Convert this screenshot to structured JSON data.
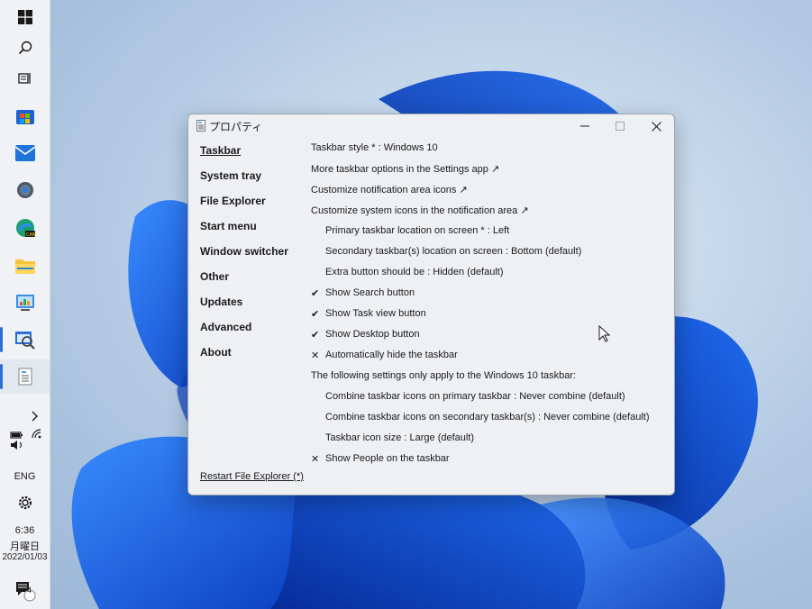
{
  "window": {
    "title": "プロパティ",
    "minimize_glyph": "─",
    "maximize_glyph": "☐",
    "close_glyph": "✕"
  },
  "nav": {
    "items": [
      {
        "label": "Taskbar",
        "active": true
      },
      {
        "label": "System tray"
      },
      {
        "label": "File Explorer"
      },
      {
        "label": "Start menu"
      },
      {
        "label": "Window switcher"
      },
      {
        "label": "Other"
      },
      {
        "label": "Updates"
      },
      {
        "label": "Advanced"
      },
      {
        "label": "About"
      }
    ]
  },
  "settings": {
    "rows": [
      {
        "text": "Taskbar style * : Windows 10",
        "indent": false,
        "mark": ""
      },
      {
        "text": "More taskbar options in the Settings app ↗",
        "indent": false,
        "mark": ""
      },
      {
        "text": "Customize notification area icons ↗",
        "indent": false,
        "mark": ""
      },
      {
        "text": "Customize system icons in the notification area ↗",
        "indent": false,
        "mark": ""
      },
      {
        "text": "Primary taskbar location on screen * : Left",
        "indent": true,
        "mark": ""
      },
      {
        "text": "Secondary taskbar(s) location on screen : Bottom (default)",
        "indent": true,
        "mark": ""
      },
      {
        "text": "Extra button should be : Hidden (default)",
        "indent": true,
        "mark": ""
      },
      {
        "text": "Show Search button",
        "indent": true,
        "mark": "✔"
      },
      {
        "text": "Show Task view button",
        "indent": true,
        "mark": "✔"
      },
      {
        "text": "Show Desktop button",
        "indent": true,
        "mark": "✔"
      },
      {
        "text": "Automatically hide the taskbar",
        "indent": true,
        "mark": "✕"
      },
      {
        "text": "The following settings only apply to the Windows 10 taskbar:",
        "indent": false,
        "mark": ""
      },
      {
        "text": "Combine taskbar icons on primary taskbar : Never combine (default)",
        "indent": true,
        "mark": ""
      },
      {
        "text": "Combine taskbar icons on secondary taskbar(s) : Never combine (default)",
        "indent": true,
        "mark": ""
      },
      {
        "text": "Taskbar icon size : Large (default)",
        "indent": true,
        "mark": ""
      },
      {
        "text": "Show People on the taskbar",
        "indent": true,
        "mark": "✕"
      }
    ]
  },
  "footer": {
    "restart_link": "Restart File Explorer (*)"
  },
  "taskbar": {
    "language": "ENG",
    "time": "6:36",
    "weekday": "月曜日",
    "date": "2022/01/03",
    "notification_count": "4",
    "icons": [
      "windows-start-icon",
      "search-icon",
      "task-view-icon",
      "store-icon",
      "mail-icon",
      "settings-icon",
      "edge-can-icon",
      "file-explorer-icon",
      "control-panel-icon",
      "magnifier-window-icon",
      "properties-app-icon"
    ]
  },
  "colors": {
    "accent": "#2b6fd6",
    "window_bg": "#eef0f3",
    "taskbar_bg": "#f0f2f6"
  }
}
